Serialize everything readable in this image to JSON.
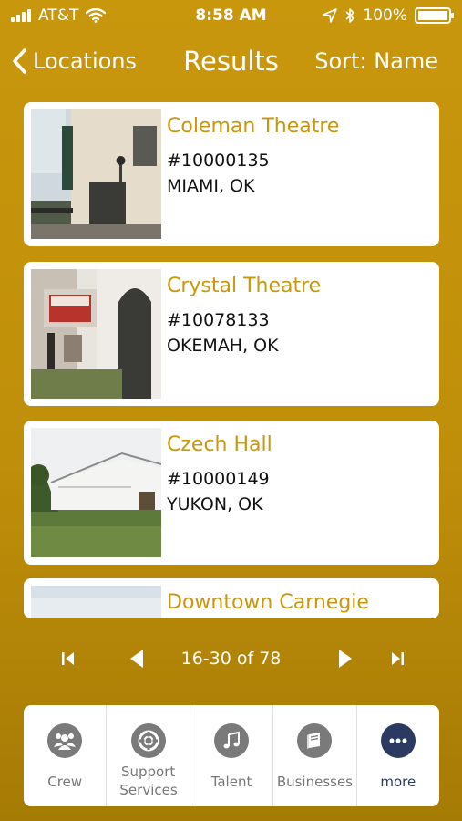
{
  "status_bar": {
    "carrier": "AT&T",
    "time": "8:58 AM",
    "battery": "100%",
    "battery_level": 1.0,
    "icons": [
      "signal-icon",
      "wifi-icon",
      "location-arrow-icon",
      "bluetooth-icon",
      "battery-icon"
    ]
  },
  "nav": {
    "back_label": "Locations",
    "title": "Results",
    "sort_label": "Sort: Name"
  },
  "results": [
    {
      "name": "Coleman Theatre",
      "number": "#10000135",
      "city": "MIAMI, OK"
    },
    {
      "name": "Crystal Theatre",
      "number": "#10078133",
      "city": "OKEMAH, OK"
    },
    {
      "name": "Czech Hall",
      "number": "#10000149",
      "city": "YUKON, OK"
    },
    {
      "name": "Downtown Carnegie"
    }
  ],
  "pager": {
    "label": "16-30 of 78",
    "icons": [
      "first-page-icon",
      "previous-page-icon",
      "next-page-icon",
      "last-page-icon"
    ]
  },
  "tabs": [
    {
      "label": "Crew",
      "icon": "crew-icon"
    },
    {
      "label": "Support Services",
      "icon": "support-icon"
    },
    {
      "label": "Talent",
      "icon": "music-note-icon"
    },
    {
      "label": "Businesses",
      "icon": "book-icon"
    },
    {
      "label": "more",
      "icon": "more-icon",
      "active": true
    }
  ],
  "colors": {
    "background": "#c9970c",
    "accent": "#c9970c",
    "active_tab": "#2b3a60",
    "tab_inactive": "#777777"
  }
}
